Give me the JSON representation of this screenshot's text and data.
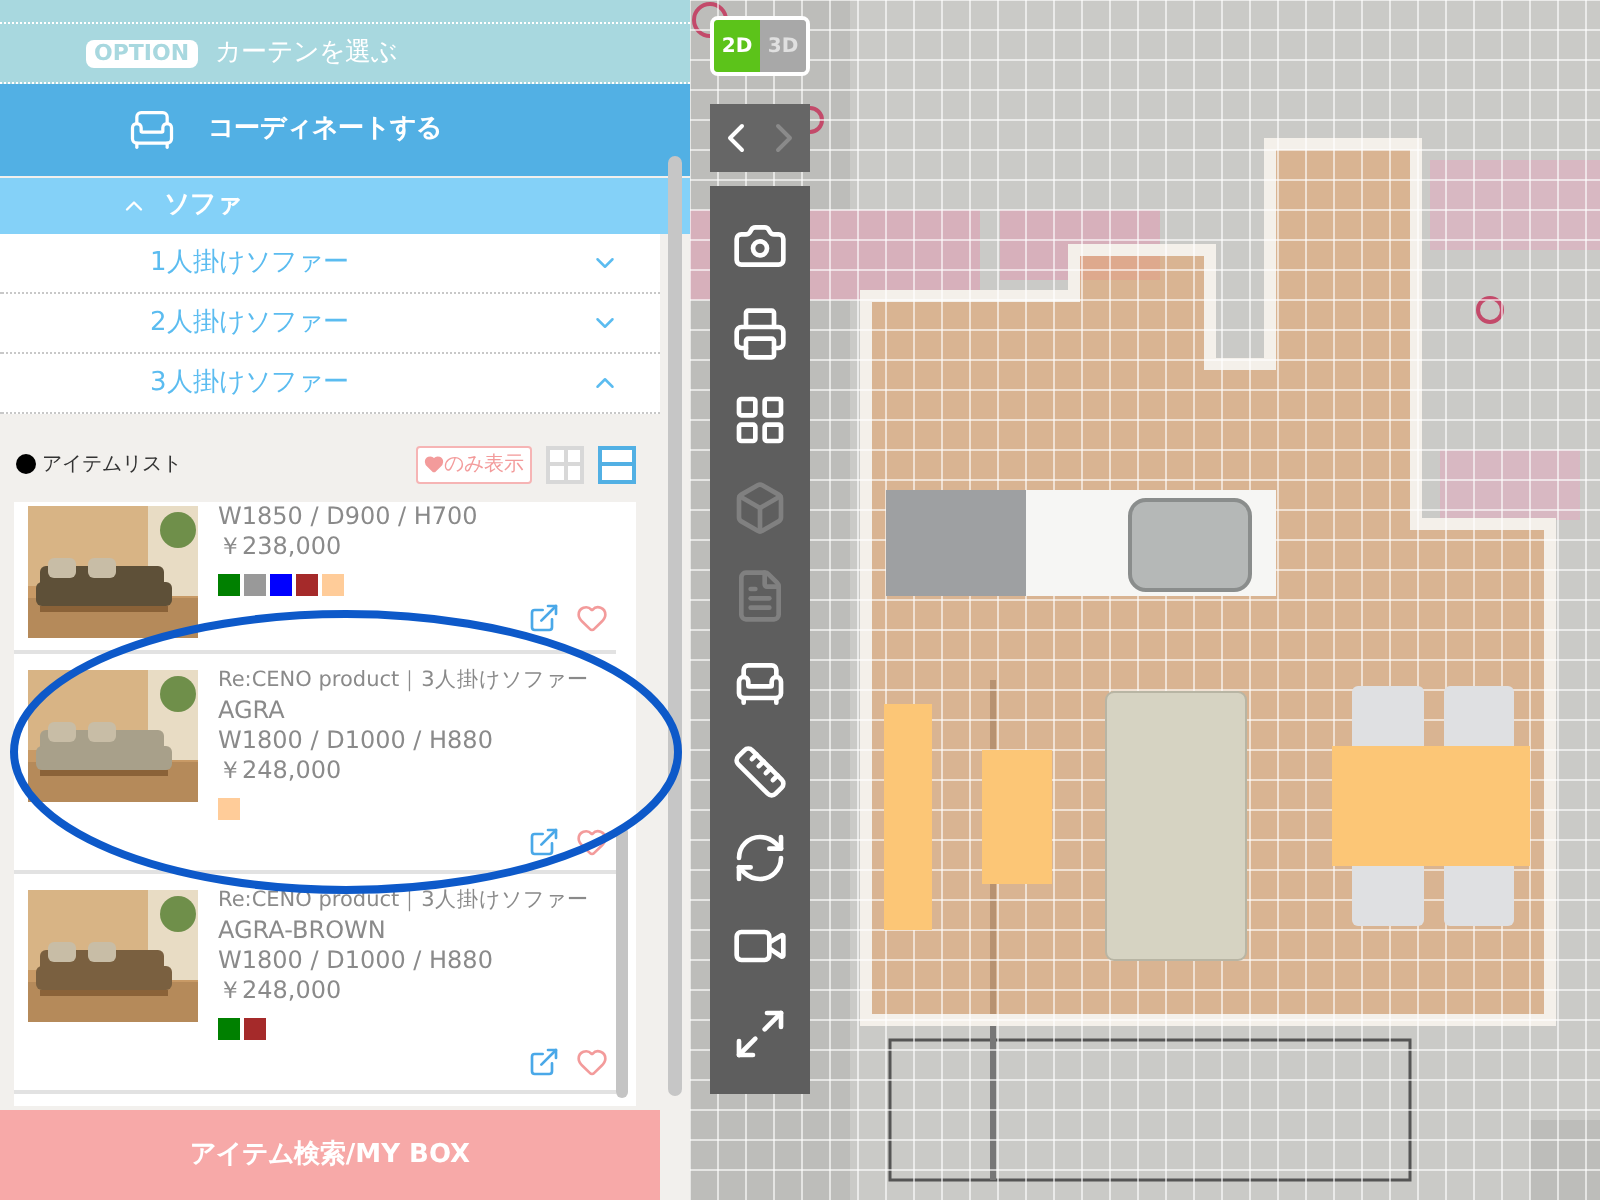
{
  "menu_options": [
    {
      "badge": "OPTION",
      "label": "カーテンを選ぶ"
    }
  ],
  "coordinate_button": {
    "label": "コーディネートする"
  },
  "category": {
    "label": "ソファ",
    "expanded": true
  },
  "subcategories": [
    {
      "label": "1人掛けソファー",
      "expanded": false
    },
    {
      "label": "2人掛けソファー",
      "expanded": false
    },
    {
      "label": "3人掛けソファー",
      "expanded": true
    }
  ],
  "item_list": {
    "title": "アイテムリスト",
    "favorites_filter": "のみ表示",
    "views": [
      {
        "kind": "grid",
        "selected": false
      },
      {
        "kind": "list",
        "selected": true
      }
    ]
  },
  "items": [
    {
      "dimensions": "W1850 / D900 / H700",
      "price": "￥238,000",
      "colors": [
        {
          "color": "#008000"
        },
        {
          "color": "#999999"
        },
        {
          "color": "#0000ff"
        },
        {
          "color": "#a52a2a"
        },
        {
          "color": "#ffcc99"
        }
      ]
    },
    {
      "title": "Re:CENO product｜3人掛けソファー",
      "name": "AGRA",
      "dimensions": "W1800 / D1000 / H880",
      "price": "￥248,000",
      "colors": [
        {
          "color": "#ffcc99"
        }
      ]
    },
    {
      "title": "Re:CENO product｜3人掛けソファー",
      "name": "AGRA-BROWN",
      "dimensions": "W1800 / D1000 / H880",
      "price": "￥248,000",
      "colors": [
        {
          "color": "#008000"
        },
        {
          "color": "#a52a2a"
        }
      ]
    }
  ],
  "search_button": {
    "label": "アイテム検索/MY BOX"
  },
  "plan_view": {
    "modes": [
      {
        "label": "2D",
        "selected": true
      },
      {
        "label": "3D",
        "selected": false
      }
    ],
    "history": {
      "back_enabled": true,
      "forward_enabled": false
    },
    "tools": [
      {
        "kind": "camera",
        "disabled": false
      },
      {
        "kind": "print",
        "disabled": false
      },
      {
        "kind": "layout",
        "disabled": false
      },
      {
        "kind": "box",
        "disabled": true
      },
      {
        "kind": "document",
        "disabled": true
      },
      {
        "kind": "furniture",
        "disabled": false
      },
      {
        "kind": "ruler",
        "disabled": false
      },
      {
        "kind": "ruler-reset",
        "disabled": false
      },
      {
        "kind": "camera-reset",
        "disabled": false
      },
      {
        "kind": "fit",
        "disabled": false
      }
    ]
  }
}
